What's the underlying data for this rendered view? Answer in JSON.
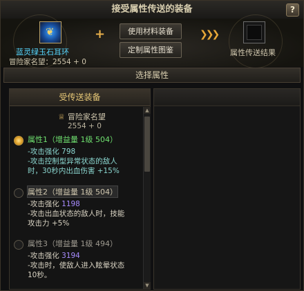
{
  "window": {
    "title": "接受属性传送的装备",
    "help_label": "?"
  },
  "source_item": {
    "icon": "earring-icon",
    "name": "蓝灵绿玉石耳环",
    "reputation_label": "冒险家名望：2554 + 0"
  },
  "buttons": {
    "use_material": "使用材料装备",
    "custom_blueprint": "定制属性图鉴"
  },
  "result": {
    "label": "属性传送结果"
  },
  "select_header": "选择属性",
  "left_panel": {
    "title": "受传送装备",
    "reputation_label": "冒险家名望",
    "reputation_value": "2554 + 0",
    "attributes": [
      {
        "title": "属性1（增益量 1级 504）",
        "selected": true,
        "line1_label": "-攻击强化",
        "line1_value": "798",
        "line2": "-攻击控制型异常状态的敌人",
        "line3": "时，30秒内出血伤害 +15%"
      },
      {
        "title": "属性2（增益量 1级 504）",
        "selected": false,
        "line1_label": "-攻击强化",
        "line1_value": "1198",
        "line2": "-攻击出血状态的敌人时，技能",
        "line3": "攻击力 +5%"
      },
      {
        "title": "属性3（增益量 1级 494）",
        "selected": false,
        "line1_label": "-攻击强化",
        "line1_value": "3194",
        "line2": "-攻击时，使敌人进入眩晕状态",
        "line3": "10秒。"
      }
    ]
  },
  "colors": {
    "accent_gold": "#e8c978",
    "item_name": "#56d7ff",
    "attr_selected": "#6fe06f",
    "value_purple": "#a88cff"
  }
}
